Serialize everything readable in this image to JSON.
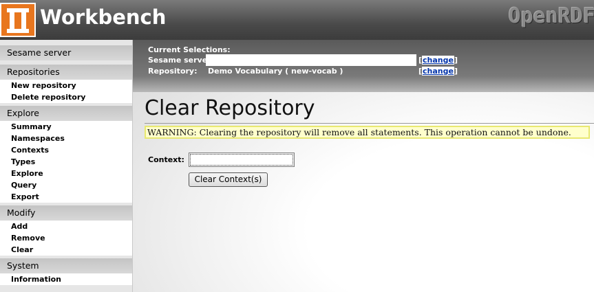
{
  "header": {
    "brand": "Workbench",
    "right_logo": "OpenRDF"
  },
  "sidebar": {
    "sesame_server": "Sesame server",
    "sections": [
      {
        "title": "Repositories",
        "items": [
          "New repository",
          "Delete repository"
        ]
      },
      {
        "title": "Explore",
        "items": [
          "Summary",
          "Namespaces",
          "Contexts",
          "Types",
          "Explore",
          "Query",
          "Export"
        ]
      },
      {
        "title": "Modify",
        "items": [
          "Add",
          "Remove",
          "Clear"
        ]
      },
      {
        "title": "System",
        "items": [
          "Information"
        ]
      }
    ]
  },
  "selections": {
    "title": "Current Selections:",
    "server_label": "Sesame server:",
    "server_value": "",
    "repository_label": "Repository:",
    "repository_value": "Demo Vocabulary ( new-vocab )",
    "change_link": "change",
    "bracket_open": "[",
    "bracket_close": "]"
  },
  "main": {
    "title": "Clear Repository",
    "warning": "WARNING: Clearing the repository will remove all statements. This operation cannot be undone.",
    "context_label": "Context:",
    "context_value": "",
    "clear_button": "Clear Context(s)"
  },
  "colors": {
    "logo_orange": "#e8761e",
    "warning_bg": "#ffffcc",
    "warning_border": "#e8e870",
    "link_blue": "#0033aa"
  }
}
